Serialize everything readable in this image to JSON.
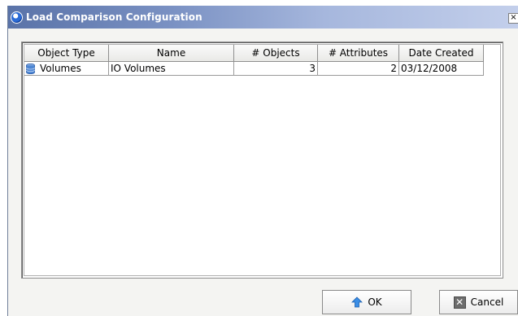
{
  "window": {
    "title": "Load Comparison Configuration",
    "close_glyph": "×"
  },
  "table": {
    "columns": [
      "Object Type",
      "Name",
      "# Objects",
      "# Attributes",
      "Date Created"
    ],
    "rows": [
      {
        "object_type": "Volumes",
        "object_icon": "volume-db-icon",
        "name": "IO Volumes",
        "objects": "3",
        "attributes": "2",
        "date_created": "03/12/2008"
      }
    ]
  },
  "buttons": {
    "ok_label": "OK",
    "ok_icon": "up-arrow-icon",
    "cancel_label": "Cancel",
    "cancel_icon": "close-box-icon"
  },
  "colors": {
    "titlebar_start": "#5a73a8",
    "titlebar_end": "#c3cfeb",
    "dialog_bg": "#f4f4f2"
  }
}
